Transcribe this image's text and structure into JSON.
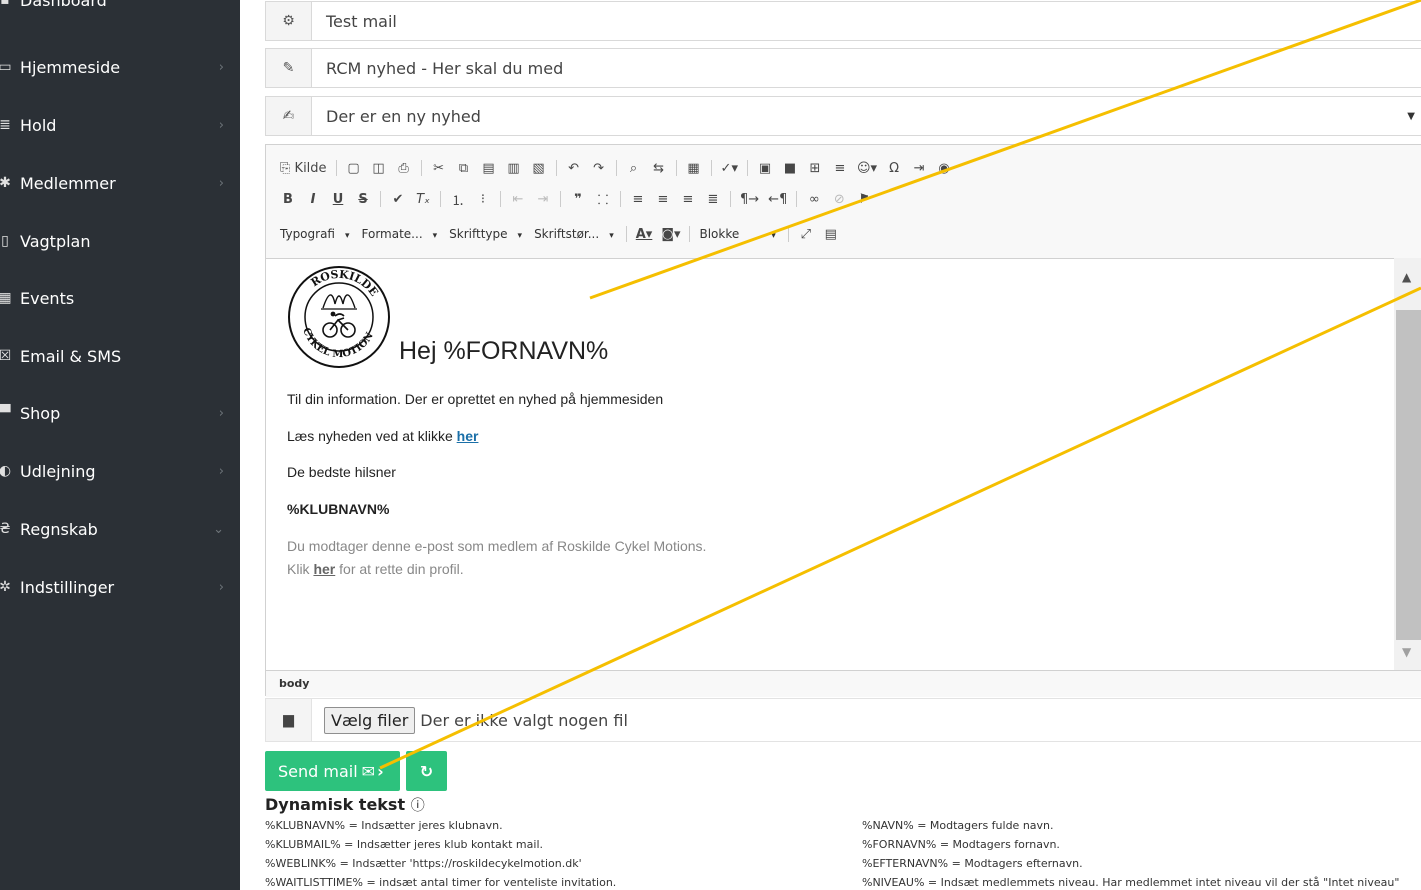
{
  "sidebar": {
    "items": [
      {
        "label": "Dashboard",
        "icon": "dashboard-icon",
        "chev": ""
      },
      {
        "label": "Hjemmeside",
        "icon": "monitor-icon",
        "chev": "›"
      },
      {
        "label": "Hold",
        "icon": "list-icon",
        "chev": "›"
      },
      {
        "label": "Medlemmer",
        "icon": "users-icon",
        "chev": "›"
      },
      {
        "label": "Vagtplan",
        "icon": "calendar-icon",
        "chev": ""
      },
      {
        "label": "Events",
        "icon": "calendar-event-icon",
        "chev": ""
      },
      {
        "label": "Email & SMS",
        "icon": "mail-icon",
        "chev": ""
      },
      {
        "label": "Shop",
        "icon": "cart-icon",
        "chev": "›"
      },
      {
        "label": "Udlejning",
        "icon": "rental-icon",
        "chev": "›"
      },
      {
        "label": "Regnskab",
        "icon": "accounting-icon",
        "chev": "⌄"
      },
      {
        "label": "Indstillinger",
        "icon": "gears-icon",
        "chev": "›"
      }
    ]
  },
  "form": {
    "from_value": "Test mail",
    "subject_value": "RCM nyhed - Her skal du med",
    "template_value": "Der er en ny nyhed"
  },
  "editor": {
    "source_label": "Kilde",
    "combos": {
      "typografi": "Typografi",
      "formater": "Formate...",
      "skrifttype": "Skrifttype",
      "skriftstorrelse": "Skriftstør...",
      "blokke": "Blokke"
    },
    "path": "body"
  },
  "email": {
    "logo_text": "ROSKILDE CYKEL MOTION",
    "greeting": "Hej %FORNAVN%",
    "line1": "Til din information. Der er oprettet en nyhed på hjemmesiden",
    "line2_prefix": "Læs nyheden ved at klikke ",
    "line2_link": "her",
    "line3": "De bedste hilsner",
    "line4": "%KLUBNAVN%",
    "footer1": "Du modtager denne e-post som medlem af Roskilde Cykel Motions.",
    "footer2_prefix": "Klik ",
    "footer2_link": "her",
    "footer2_suffix": " for at rette din profil."
  },
  "file": {
    "button": "Vælg filer",
    "status": "Der er ikke valgt nogen fil"
  },
  "actions": {
    "send_label": "Send mail",
    "refresh_icon": "refresh-icon"
  },
  "dynamic": {
    "title": "Dynamisk tekst",
    "left": [
      "%KLUBNAVN% = Indsætter jeres klubnavn.",
      "%KLUBMAIL% = Indsætter jeres klub kontakt mail.",
      "%WEBLINK% = Indsætter 'https://roskildecykelmotion.dk'",
      "%WAITLISTTIME% = indsæt antal timer for venteliste invitation."
    ],
    "right": [
      "%NAVN% = Modtagers fulde navn.",
      "%FORNAVN% = Modtagers fornavn.",
      "%EFTERNAVN% = Modtagers efternavn.",
      "%NIVEAU% = Indsæt medlemmets niveau. Har medlemmet intet niveau vil der stå \"Intet niveau\""
    ]
  },
  "colors": {
    "sidebar_bg": "#2b3036",
    "button_green": "#2dc27d",
    "annotation_line": "#f5bf00",
    "link_blue": "#1a6fa8"
  }
}
